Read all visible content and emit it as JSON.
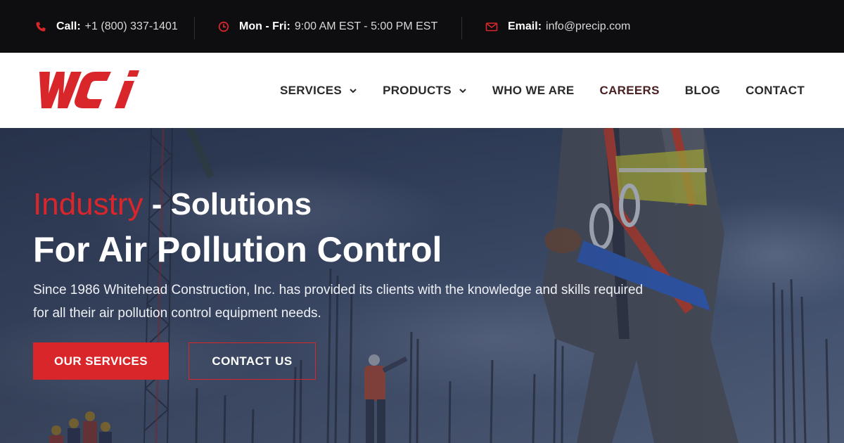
{
  "topbar": {
    "call": {
      "label": "Call:",
      "value": "+1 (800) 337-1401",
      "icon": "phone-icon"
    },
    "hours": {
      "label": "Mon - Fri:",
      "value": "9:00 AM EST - 5:00 PM EST",
      "icon": "clock-icon"
    },
    "email": {
      "label": "Email:",
      "value": "info@precip.com",
      "icon": "envelope-icon"
    }
  },
  "logo": {
    "text": "WCi"
  },
  "nav": {
    "items": [
      {
        "label": "SERVICES",
        "has_dropdown": true
      },
      {
        "label": "PRODUCTS",
        "has_dropdown": true
      },
      {
        "label": "WHO WE ARE",
        "has_dropdown": false
      },
      {
        "label": "CAREERS",
        "has_dropdown": false,
        "active": true
      },
      {
        "label": "BLOG",
        "has_dropdown": false
      },
      {
        "label": "CONTACT",
        "has_dropdown": false
      }
    ]
  },
  "hero": {
    "headline_accent": "Industry",
    "headline_rest": " - Solutions",
    "headline_line2": "For Air Pollution Control",
    "subtext": "Since 1986 Whitehead Construction, Inc. has provided its clients with the knowledge and skills required for all their air pollution control equipment needs.",
    "primary_button": "OUR SERVICES",
    "secondary_button": "CONTACT US"
  },
  "colors": {
    "accent": "#d9262b",
    "topbar_bg": "#0e0d0f",
    "nav_text": "#2a2a2a",
    "nav_active": "#4a1f22"
  }
}
